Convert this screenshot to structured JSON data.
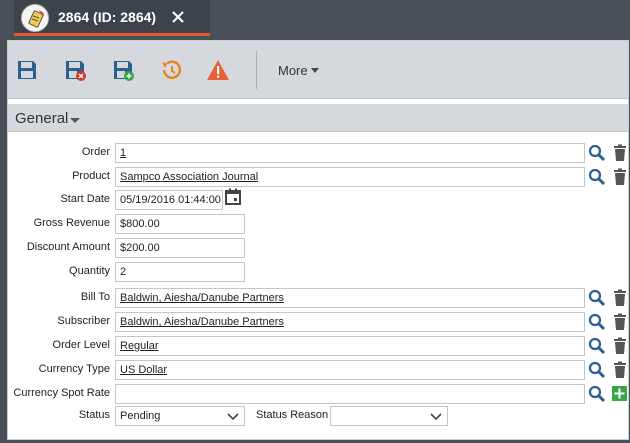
{
  "window": {
    "tab_title": "2864 (ID: 2864)"
  },
  "toolbar": {
    "more_label": "More"
  },
  "section": {
    "title": "General"
  },
  "form": {
    "order": {
      "label": "Order",
      "value": "1"
    },
    "product": {
      "label": "Product",
      "value": "Sampco Association Journal"
    },
    "start_date": {
      "label": "Start Date",
      "value": "05/19/2016 01:44:00"
    },
    "gross_revenue": {
      "label": "Gross Revenue",
      "value": "$800.00"
    },
    "discount_amount": {
      "label": "Discount Amount",
      "value": "$200.00"
    },
    "quantity": {
      "label": "Quantity",
      "value": "2"
    },
    "bill_to": {
      "label": "Bill To",
      "value": "Baldwin, Aiesha/Danube Partners"
    },
    "subscriber": {
      "label": "Subscriber",
      "value": "Baldwin, Aiesha/Danube Partners"
    },
    "order_level": {
      "label": "Order Level",
      "value": "Regular"
    },
    "currency_type": {
      "label": "Currency Type",
      "value": "US Dollar"
    },
    "currency_spot_rate": {
      "label": "Currency Spot Rate",
      "value": ""
    },
    "status": {
      "label": "Status",
      "value": "Pending"
    },
    "status_reason": {
      "label": "Status Reason",
      "value": ""
    }
  },
  "colors": {
    "accent": "#e05a2b",
    "toolbar_bg": "#d5d9de",
    "icon_blue": "#2a5f8e",
    "add_green": "#3aa64a"
  },
  "icons": [
    "app-icon",
    "close-icon",
    "save-icon",
    "save-close-icon",
    "save-new-icon",
    "history-icon",
    "warning-icon",
    "search-icon",
    "trash-icon",
    "calendar-icon",
    "add-icon",
    "chevron-down-icon"
  ]
}
